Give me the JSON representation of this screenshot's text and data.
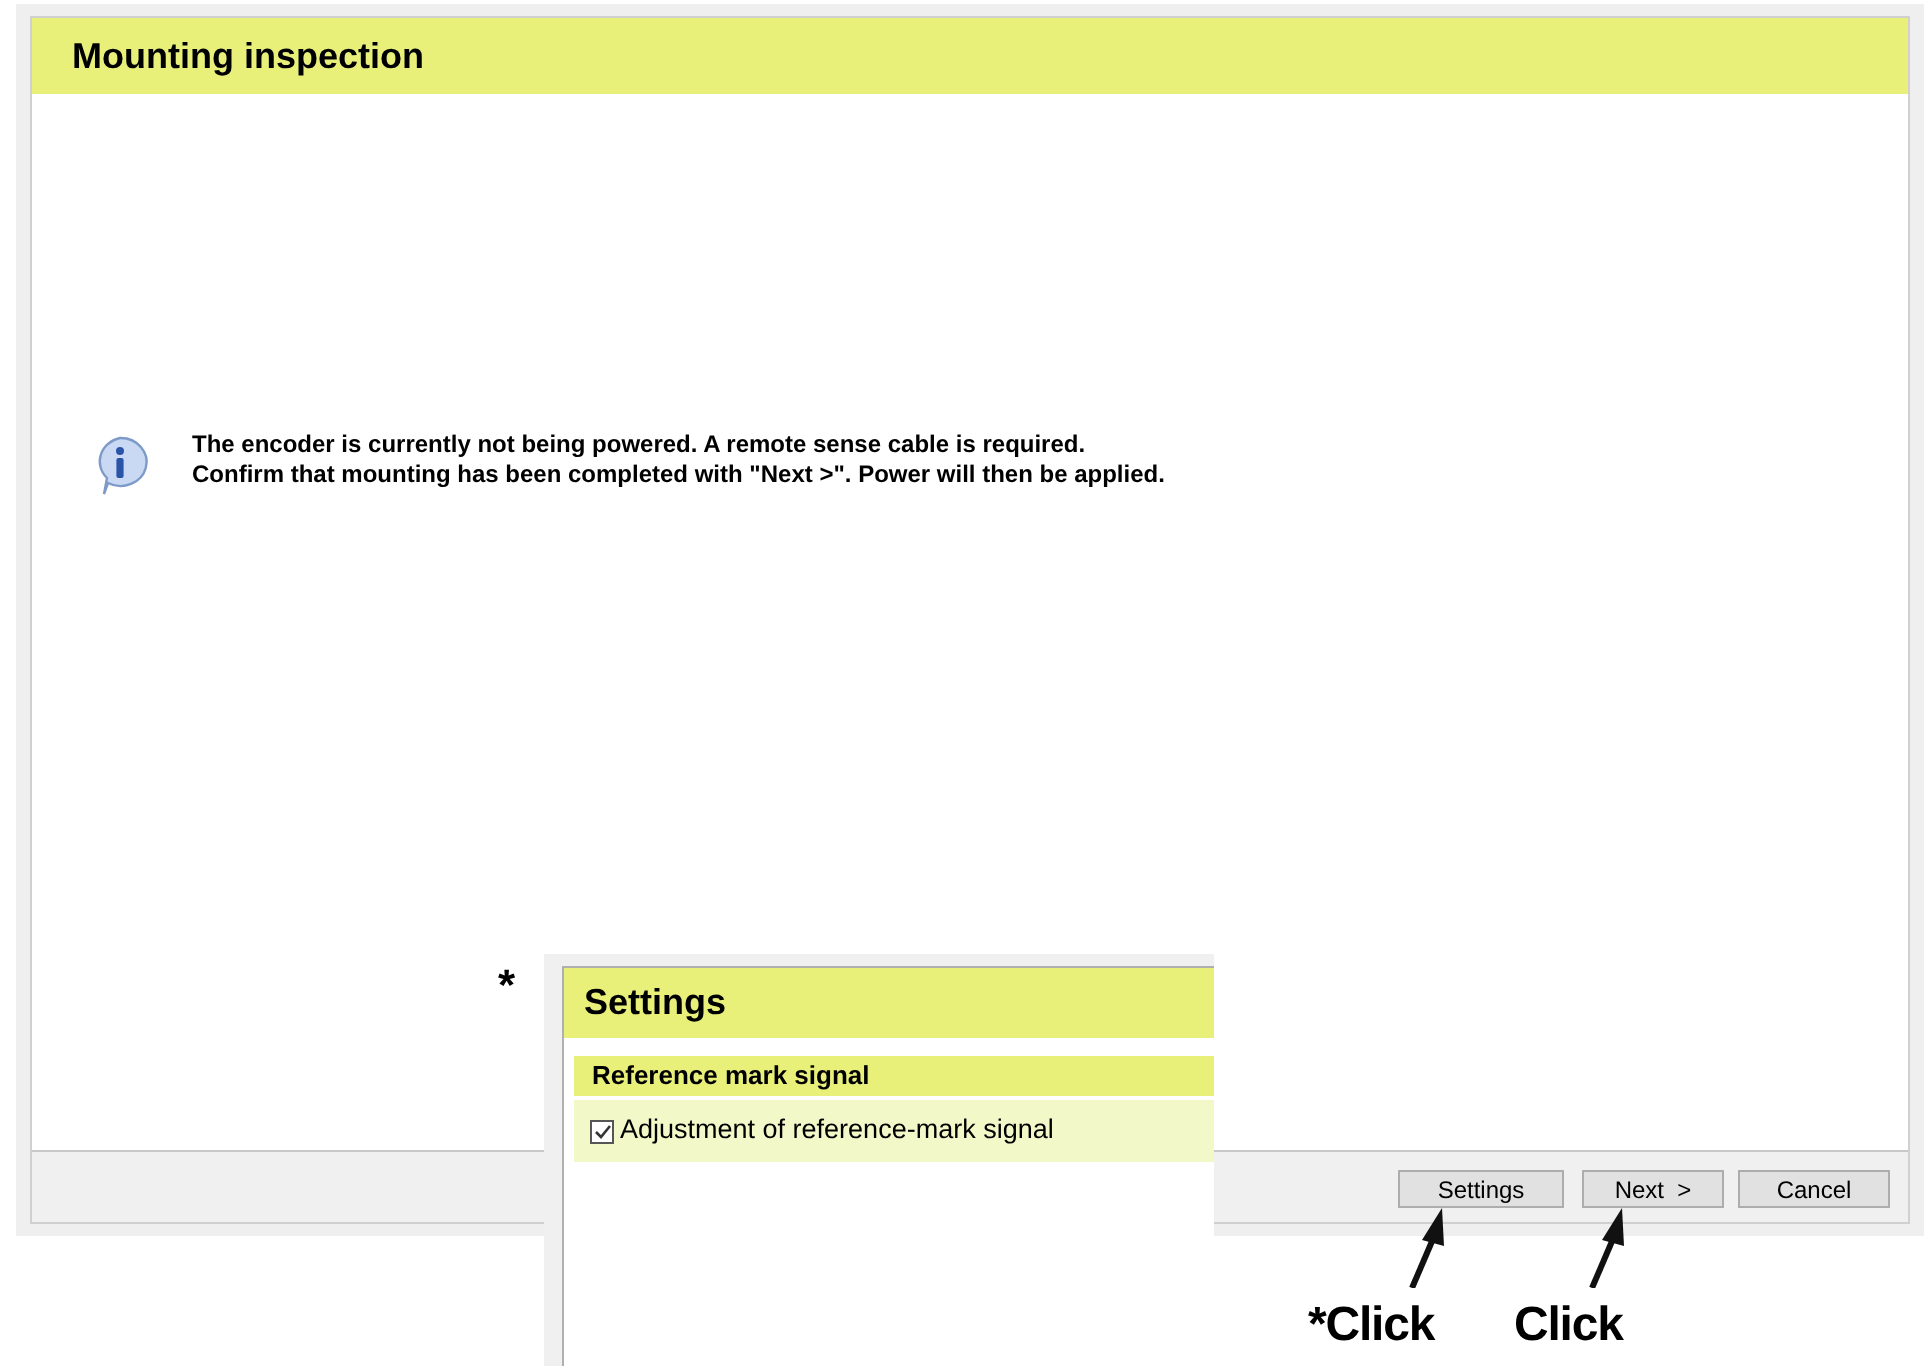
{
  "window": {
    "title": "Mounting inspection"
  },
  "message": {
    "lines": [
      "The encoder is currently not being powered. A remote sense cable is required.",
      "Confirm that mounting has been completed with \"Next >\". Power will then be applied."
    ]
  },
  "buttons": [
    {
      "label": "Settings"
    },
    {
      "label": "Next  >"
    },
    {
      "label": "Cancel"
    }
  ],
  "settings_window": {
    "title": "Settings",
    "section": "Reference mark signal",
    "option": {
      "label": "Adjustment of reference-mark signal",
      "checked": true
    }
  },
  "annotations": {
    "asterisk": "*",
    "callouts": [
      {
        "label": "*Click"
      },
      {
        "label": "Click"
      }
    ]
  }
}
